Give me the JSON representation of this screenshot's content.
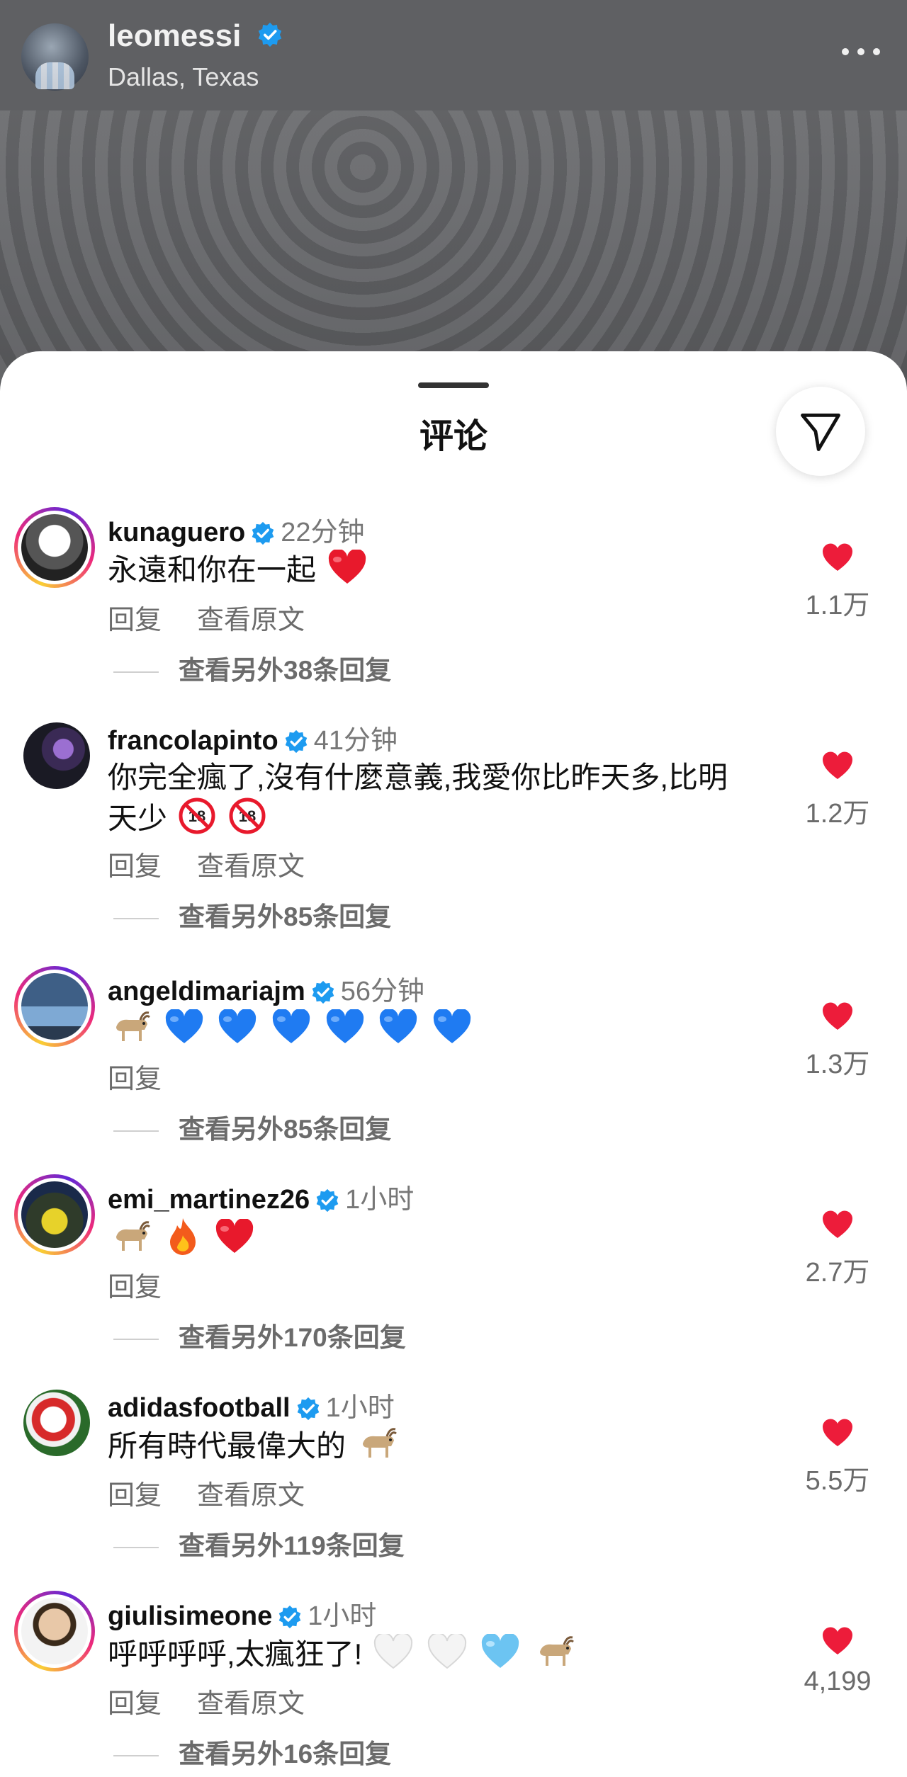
{
  "post": {
    "username": "leomessi",
    "location": "Dallas, Texas",
    "more_icon": "more-horizontal-icon"
  },
  "sheet": {
    "title": "评论",
    "share_icon": "send-icon"
  },
  "comments": [
    {
      "user": "kunaguero",
      "time": "22分钟",
      "text": "永遠和你在一起",
      "emoji": [
        "red-heart"
      ],
      "actions": [
        "回复",
        "查看原文"
      ],
      "replies": "查看另外38条回复",
      "likes": "1.1万",
      "story_ring": true
    },
    {
      "user": "francolapinto",
      "time": "41分钟",
      "text_line1": "你完全瘋了,沒有什麼意義,我愛你比昨天多,比明",
      "text_line2": "天少",
      "emoji": [
        "no-under-18",
        "no-under-18"
      ],
      "actions": [
        "回复",
        "查看原文"
      ],
      "replies": "查看另外85条回复",
      "likes": "1.2万",
      "story_ring": false
    },
    {
      "user": "angeldimariajm",
      "time": "56分钟",
      "text": "",
      "emoji": [
        "goat",
        "blue-heart",
        "blue-heart",
        "blue-heart",
        "blue-heart",
        "blue-heart",
        "blue-heart"
      ],
      "actions": [
        "回复"
      ],
      "replies": "查看另外85条回复",
      "likes": "1.3万",
      "story_ring": true
    },
    {
      "user": "emi_martinez26",
      "time": "1小时",
      "text": "",
      "emoji": [
        "goat",
        "fire",
        "red-heart"
      ],
      "actions": [
        "回复"
      ],
      "replies": "查看另外170条回复",
      "likes": "2.7万",
      "story_ring": true
    },
    {
      "user": "adidasfootball",
      "time": "1小时",
      "text": "所有時代最偉大的",
      "emoji": [
        "goat"
      ],
      "actions": [
        "回复",
        "查看原文"
      ],
      "replies": "查看另外119条回复",
      "likes": "5.5万",
      "story_ring": false
    },
    {
      "user": "giulisimeone",
      "time": "1小时",
      "text": "呼呼呼呼,太瘋狂了!",
      "emoji": [
        "white-heart",
        "white-heart",
        "light-blue-heart",
        "goat"
      ],
      "actions": [
        "回复",
        "查看原文"
      ],
      "replies": "查看另外16条回复",
      "likes": "4,199",
      "story_ring": true
    }
  ],
  "colors": {
    "like_red": "#ed1c3a",
    "verified_blue": "#1d9bf0",
    "muted_text": "#6b6b6b"
  }
}
